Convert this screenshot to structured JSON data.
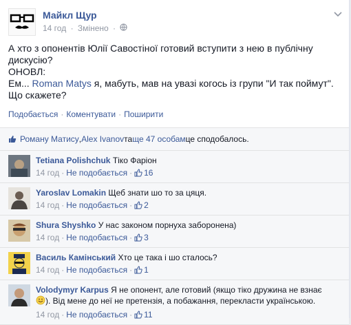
{
  "post": {
    "author": "Майкл Щур",
    "time": "14 год",
    "edited": "Змінено",
    "text_line1": "А хто з опонентів Юлії Савостіної готовий вступити з нею в публічну дискусію?",
    "text_line2": "ОНОВЛ:",
    "text_line3_pre": "Ем... ",
    "text_line3_link": "Roman Matys",
    "text_line3_post": " я, мабуть, мав на увазі когось із групи \"И так поймут\". Що скажете?",
    "actions": [
      "Подобається",
      "Коментувати",
      "Поширити"
    ]
  },
  "likes": {
    "name1": "Роману Матису",
    "sep1": ", ",
    "name2": "Alex Ivanov",
    "mid": " та ",
    "others": "ще 47 особам",
    "suffix": " це сподобалось."
  },
  "comments": [
    {
      "name": "Tetiana Polishchuk",
      "text": "Тіко Фаріон",
      "time": "14 год",
      "like_label": "Не подобається",
      "likes": "16"
    },
    {
      "name": "Yaroslav Lomakin",
      "text": "Щеб знати шо то за цяця.",
      "time": "14 год",
      "like_label": "Не подобається",
      "likes": "2"
    },
    {
      "name": "Shura Shyshko",
      "text": "У нас законом порнуха заборонена)",
      "time": "14 год",
      "like_label": "Не подобається",
      "likes": "3"
    },
    {
      "name": "Василь Камінський",
      "text": "Хто це така і шо сталось?",
      "time": "14 год",
      "like_label": "Не подобається",
      "likes": "1"
    },
    {
      "name": "Volodymyr Karpus",
      "text": "Я не опонент, але готовий (якщо тіко дружина не взнає",
      "text2": "). Від мене до неї не претензія, а побажання, перекласти українською.",
      "time": "14 год",
      "like_label": "Не подобається",
      "likes": "11"
    }
  ]
}
